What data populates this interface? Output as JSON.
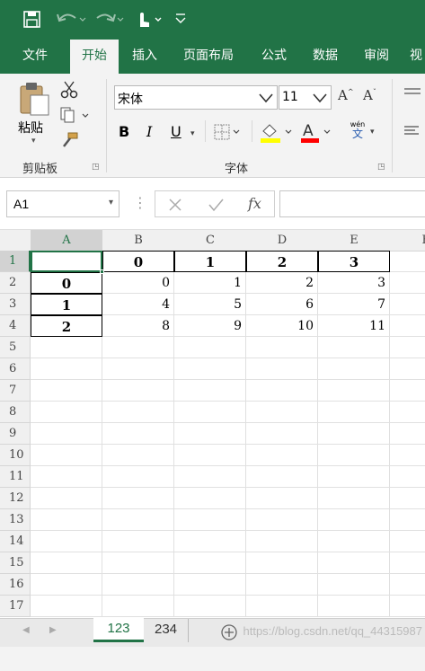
{
  "ribbon_tabs": [
    "文件",
    "开始",
    "插入",
    "页面布局",
    "公式",
    "数据",
    "审阅",
    "视"
  ],
  "clipboard": {
    "paste_label": "粘贴",
    "group_label": "剪贴板"
  },
  "font": {
    "name": "宋体",
    "size": "11",
    "group_label": "字体",
    "wen_top": "wén",
    "wen_bottom": "文"
  },
  "font_buttons": {
    "bold": "B",
    "italic": "I",
    "underline": "U"
  },
  "formula_bar": {
    "name_box": "A1",
    "fx": "fx",
    "formula": ""
  },
  "columns": [
    "A",
    "B",
    "C",
    "D",
    "E",
    "F"
  ],
  "rows": [
    "1",
    "2",
    "3",
    "4",
    "5",
    "6",
    "7",
    "8",
    "9",
    "10",
    "11",
    "12",
    "13",
    "14",
    "15",
    "16",
    "17"
  ],
  "cells": {
    "B1": "0",
    "C1": "1",
    "D1": "2",
    "E1": "3",
    "A2": "0",
    "B2": "0",
    "C2": "1",
    "D2": "2",
    "E2": "3",
    "A3": "1",
    "B3": "4",
    "C3": "5",
    "D3": "6",
    "E3": "7",
    "A4": "2",
    "B4": "8",
    "C4": "9",
    "D4": "10",
    "E4": "11"
  },
  "sheets": [
    "123",
    "234"
  ],
  "active_sheet": "123",
  "watermark": "https://blog.csdn.net/qq_44315987",
  "colors": {
    "excel_green": "#217346",
    "highlight_yellow": "#ffff00",
    "font_red": "#ff0000"
  }
}
